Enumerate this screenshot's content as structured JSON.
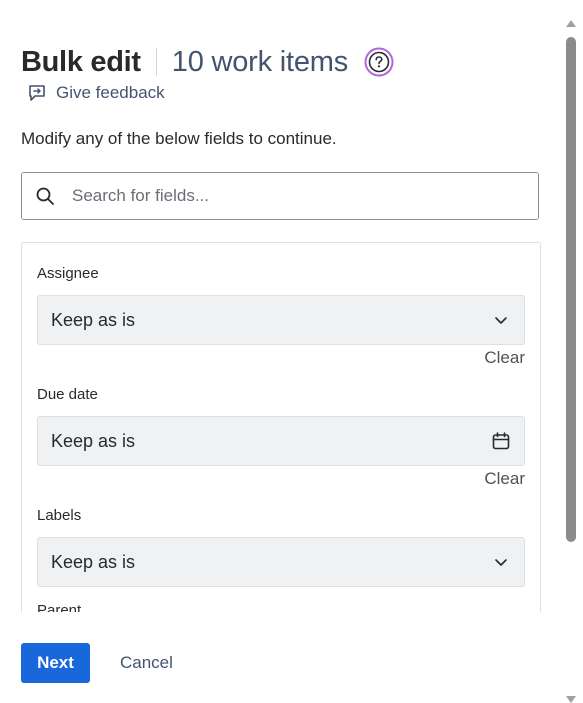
{
  "header": {
    "title": "Bulk edit",
    "count": "10 work items",
    "help_icon": "question-circle-icon"
  },
  "feedback": {
    "label": "Give feedback",
    "icon": "feedback-icon"
  },
  "description": "Modify any of the below fields to continue.",
  "search": {
    "placeholder": "Search for fields...",
    "value": "",
    "icon": "search-icon"
  },
  "fields": [
    {
      "label": "Assignee",
      "value": "Keep as is",
      "control_icon": "chevron-down-icon",
      "clear_label": "Clear"
    },
    {
      "label": "Due date",
      "value": "Keep as is",
      "control_icon": "calendar-icon",
      "clear_label": "Clear"
    },
    {
      "label": "Labels",
      "value": "Keep as is",
      "control_icon": "chevron-down-icon"
    },
    {
      "label": "Parent"
    }
  ],
  "footer": {
    "primary_label": "Next",
    "secondary_label": "Cancel"
  },
  "colors": {
    "primary": "#1868db",
    "help_icon": "#9c4fd6",
    "field_bg": "#f0f1f2"
  }
}
